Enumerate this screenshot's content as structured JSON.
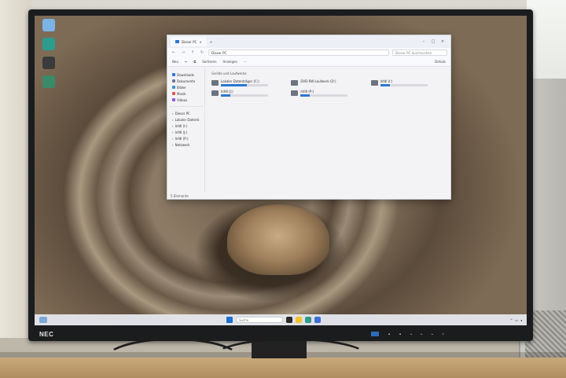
{
  "monitor": {
    "brand": "NEC"
  },
  "explorer": {
    "window_title": "Dieser PC",
    "address": "Dieser PC",
    "search_placeholder": "Dieser PC durchsuchen",
    "toolbar": {
      "new": "Neu",
      "sort": "Sortieren",
      "view": "Anzeigen",
      "more": "···",
      "details": "Details"
    },
    "sidebar": {
      "quick": [
        {
          "label": "Downloads",
          "color": "#2b77d4"
        },
        {
          "label": "Dokumente",
          "color": "#6b7a90"
        },
        {
          "label": "Bilder",
          "color": "#3a8fd8"
        },
        {
          "label": "Musik",
          "color": "#e0574f"
        },
        {
          "label": "Videos",
          "color": "#8a5ad6"
        }
      ],
      "tree": [
        {
          "label": "Dieser PC"
        },
        {
          "label": "Lokaler Datentr."
        },
        {
          "label": "Infdl (I:)"
        },
        {
          "label": "Infdl (J:)"
        },
        {
          "label": "Infdl (P:)"
        },
        {
          "label": "Netzwerk"
        }
      ]
    },
    "group_title": "Geräte und Laufwerke",
    "drives": [
      {
        "name": "Lokaler Datenträger (C:)",
        "free": "",
        "used_fraction": 0.55
      },
      {
        "name": "DVD-RW-Laufwerk (D:)",
        "free": "",
        "used_fraction": 0
      },
      {
        "name": "Infdl (I:)",
        "free": "",
        "used_fraction": 0.2
      },
      {
        "name": "Infdl (J:)",
        "free": "",
        "used_fraction": 0.2
      },
      {
        "name": "Infdl (P:)",
        "free": "",
        "used_fraction": 0.2
      }
    ],
    "status": "5 Elemente"
  },
  "taskbar": {
    "search_placeholder": "Suche"
  }
}
